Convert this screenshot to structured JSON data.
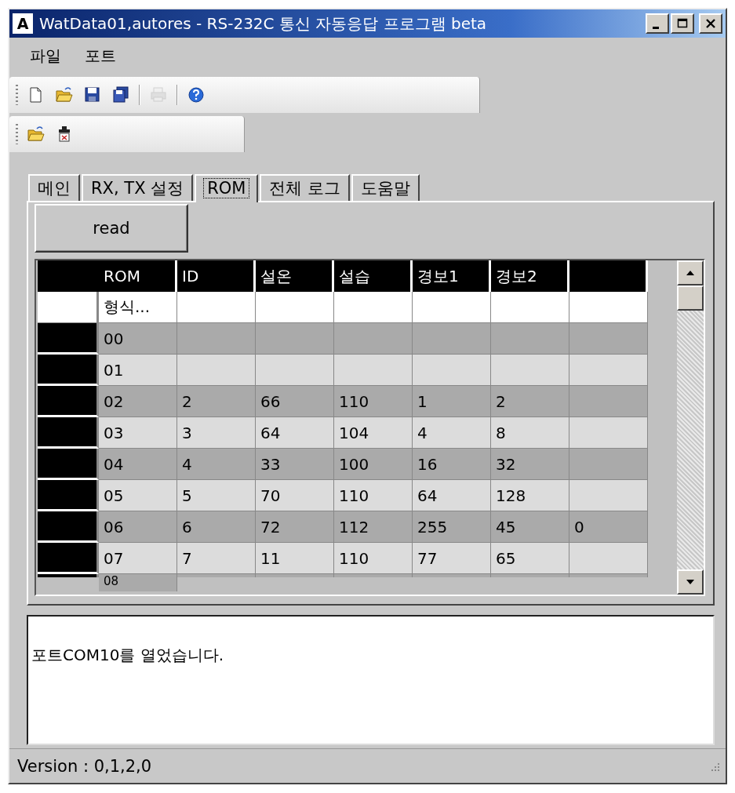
{
  "window": {
    "title": "WatData01,autores - RS-232C 통신 자동응답 프로그램 beta",
    "app_icon": "A"
  },
  "menu": [
    "파일",
    "포트"
  ],
  "toolbar": [
    {
      "kind": "new",
      "disabled": false
    },
    {
      "kind": "open",
      "disabled": false
    },
    {
      "kind": "save",
      "disabled": false
    },
    {
      "kind": "save_all",
      "disabled": false
    },
    {
      "kind": "separator"
    },
    {
      "kind": "print",
      "disabled": true
    },
    {
      "kind": "separator"
    },
    {
      "kind": "help",
      "disabled": false
    }
  ],
  "toolbar2": [
    {
      "kind": "open",
      "disabled": false
    },
    {
      "kind": "port",
      "disabled": false
    }
  ],
  "tabs": [
    {
      "label": "메인",
      "selected": false
    },
    {
      "label": "RX, TX 설정",
      "selected": false
    },
    {
      "label": "ROM",
      "selected": true
    },
    {
      "label": "전체 로그",
      "selected": false
    },
    {
      "label": "도움말",
      "selected": false
    }
  ],
  "read_button": "read",
  "table": {
    "columns": [
      {
        "kind": "heading",
        "label": "ROM"
      },
      {
        "kind": "heading",
        "label": "ID"
      },
      {
        "kind": "heading",
        "label": "설온"
      },
      {
        "kind": "heading",
        "label": "설습"
      },
      {
        "kind": "heading",
        "label": "경보1"
      },
      {
        "kind": "heading",
        "label": "경보2"
      },
      {
        "kind": "blank"
      }
    ],
    "rows": [
      {
        "kind": "format",
        "cells": [
          "형식..."
        ]
      },
      {
        "kind": "data",
        "cells": [
          "00"
        ]
      },
      {
        "kind": "data",
        "cells": [
          "01"
        ]
      },
      {
        "kind": "data",
        "cells": [
          "02",
          "2",
          "66",
          "110",
          "1",
          "2"
        ]
      },
      {
        "kind": "data",
        "cells": [
          "03",
          "3",
          "64",
          "104",
          "4",
          "8"
        ]
      },
      {
        "kind": "data",
        "cells": [
          "04",
          "4",
          "33",
          "100",
          "16",
          "32"
        ]
      },
      {
        "kind": "data",
        "cells": [
          "05",
          "5",
          "70",
          "110",
          "64",
          "128"
        ]
      },
      {
        "kind": "data",
        "cells": [
          "06",
          "6",
          "72",
          "112",
          "255",
          "45",
          "0"
        ]
      },
      {
        "kind": "data",
        "cells": [
          "07",
          "7",
          "11",
          "110",
          "77",
          "65"
        ]
      },
      {
        "kind": "data",
        "cells": [
          "08"
        ]
      }
    ]
  },
  "log": [
    "포트COM10를 열었습니다."
  ],
  "status_bar": "Version : 0,1,2,0"
}
